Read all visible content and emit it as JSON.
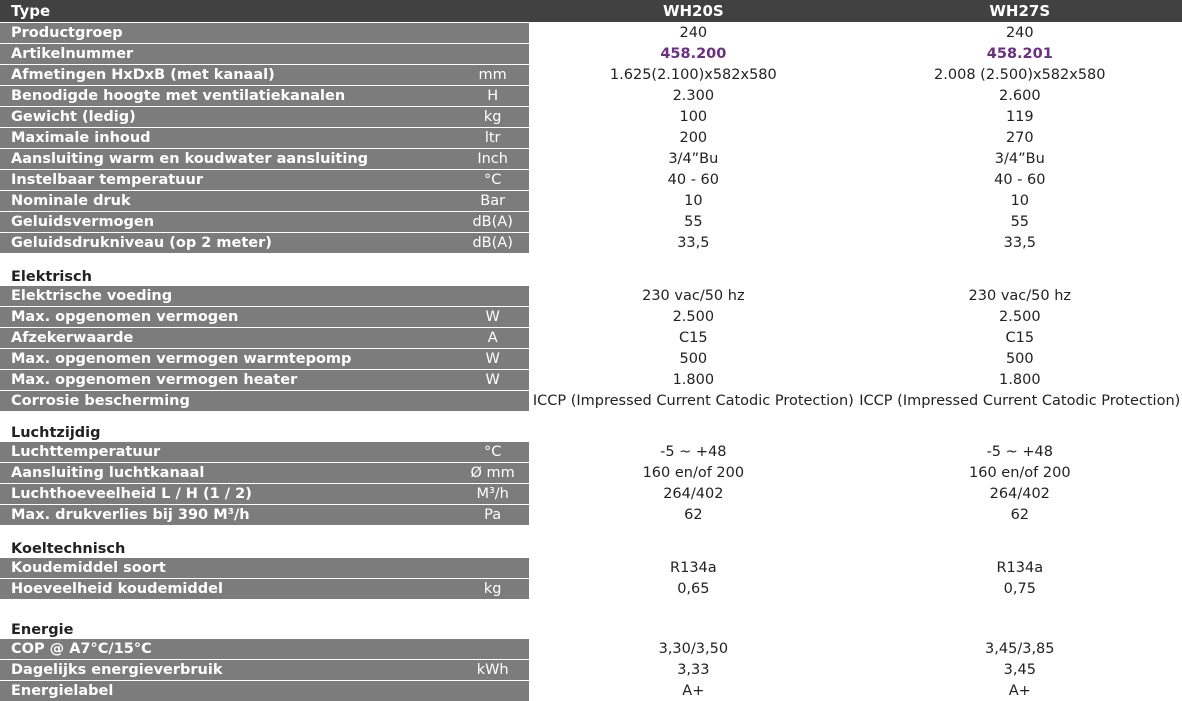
{
  "header": {
    "label": "Type",
    "unit": "",
    "col1": "WH20S",
    "col2": "WH27S"
  },
  "rows_general": [
    {
      "label": "Productgroep",
      "unit": "",
      "v1": "240",
      "v2": "240"
    },
    {
      "label": "Artikelnummer",
      "unit": "",
      "v1": "458.200",
      "v2": "458.201"
    },
    {
      "label": "Afmetingen HxDxB (met kanaal)",
      "unit": "mm",
      "v1": "1.625(2.100)x582x580",
      "v2": "2.008 (2.500)x582x580"
    },
    {
      "label": "Benodigde hoogte met ventilatiekanalen",
      "unit": "H",
      "v1": "2.300",
      "v2": "2.600"
    },
    {
      "label": "Gewicht (ledig)",
      "unit": "kg",
      "v1": "100",
      "v2": "119"
    },
    {
      "label": "Maximale inhoud",
      "unit": "ltr",
      "v1": "200",
      "v2": "270"
    },
    {
      "label": "Aansluiting warm en koudwater aansluiting",
      "unit": "Inch",
      "v1": "3/4”Bu",
      "v2": "3/4”Bu"
    },
    {
      "label": "Instelbaar temperatuur",
      "unit": "°C",
      "v1": "40 - 60",
      "v2": "40 - 60"
    },
    {
      "label": "Nominale druk",
      "unit": "Bar",
      "v1": "10",
      "v2": "10"
    },
    {
      "label": "Geluidsvermogen",
      "unit": "dB(A)",
      "v1": "55",
      "v2": "55"
    },
    {
      "label": "Geluidsdrukniveau (op 2 meter)",
      "unit": "dB(A)",
      "v1": "33,5",
      "v2": "33,5"
    }
  ],
  "sections": {
    "elektrisch": {
      "title": "Elektrisch",
      "rows": [
        {
          "label": "Elektrische voeding",
          "unit": "",
          "v1": "230 vac/50 hz",
          "v2": "230 vac/50 hz"
        },
        {
          "label": "Max. opgenomen vermogen",
          "unit": "W",
          "v1": "2.500",
          "v2": "2.500"
        },
        {
          "label": "Afzekerwaarde",
          "unit": "A",
          "v1": "C15",
          "v2": "C15"
        },
        {
          "label": "Max. opgenomen vermogen warmtepomp",
          "unit": "W",
          "v1": "500",
          "v2": "500"
        },
        {
          "label": "Max. opgenomen vermogen heater",
          "unit": "W",
          "v1": "1.800",
          "v2": "1.800"
        },
        {
          "label": "Corrosie bescherming",
          "unit": "",
          "v1": "ICCP (Impressed Current Catodic Protection)",
          "v2": "ICCP (Impressed Current Catodic Protection)"
        }
      ]
    },
    "luchtzijdig": {
      "title": "Luchtzijdig",
      "rows": [
        {
          "label": "Luchttemperatuur",
          "unit": "°C",
          "v1": "-5 ~ +48",
          "v2": "-5 ~ +48"
        },
        {
          "label": "Aansluiting luchtkanaal",
          "unit": "Ø mm",
          "v1": "160 en/of 200",
          "v2": "160 en/of 200"
        },
        {
          "label": "Luchthoeveelheid L / H (1 / 2)",
          "unit": "M³/h",
          "v1": "264/402",
          "v2": "264/402"
        },
        {
          "label": "Max. drukverlies bij 390 M³/h",
          "unit": "Pa",
          "v1": "62",
          "v2": "62"
        }
      ]
    },
    "koeltechnisch": {
      "title": "Koeltechnisch",
      "rows": [
        {
          "label": "Koudemiddel soort",
          "unit": "",
          "v1": "R134a",
          "v2": "R134a"
        },
        {
          "label": "Hoeveelheid koudemiddel",
          "unit": "kg",
          "v1": "0,65",
          "v2": "0,75"
        }
      ]
    },
    "energie": {
      "title": "Energie",
      "rows": [
        {
          "label": "COP @ A7°C/15°C",
          "unit": "",
          "v1": "3,30/3,50",
          "v2": "3,45/3,85"
        },
        {
          "label": "Dagelijks energieverbruik",
          "unit": "kWh",
          "v1": "3,33",
          "v2": "3,45"
        },
        {
          "label": "Energielabel",
          "unit": "",
          "v1": "A+",
          "v2": "A+"
        }
      ]
    }
  },
  "colors": {
    "header_bg": "#414141",
    "label_bg": "#7c7c7c",
    "article_number": "#6a2e83"
  }
}
